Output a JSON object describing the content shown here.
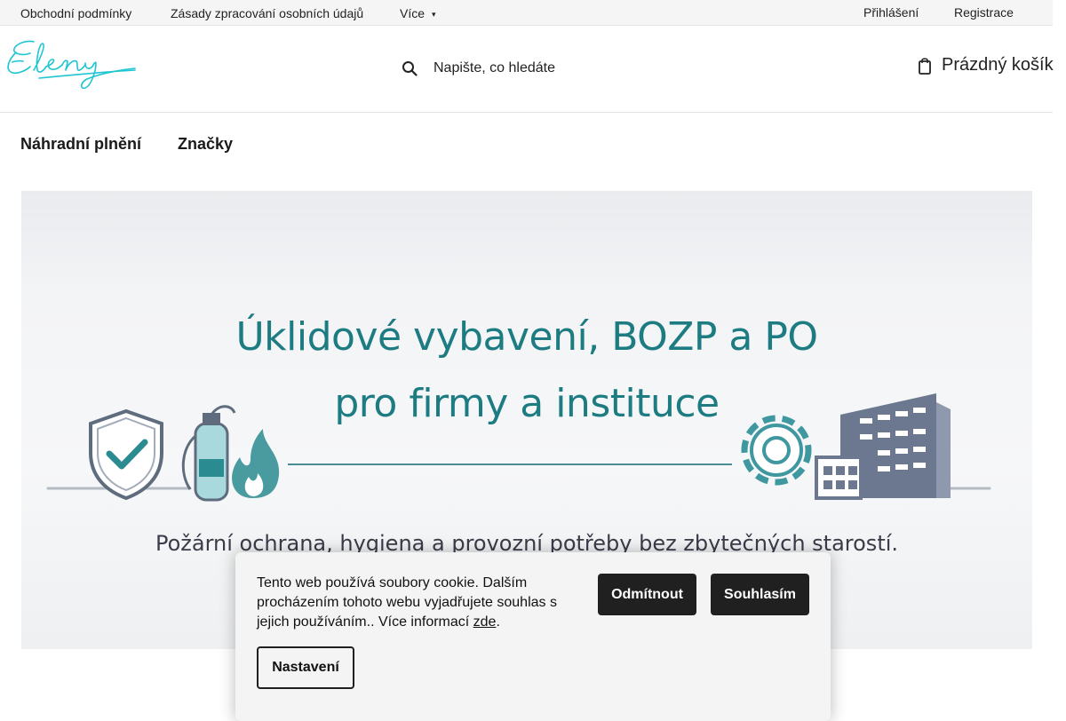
{
  "topbar": {
    "links": [
      "Obchodní podmínky",
      "Zásady zpracování osobních údajů",
      "Více"
    ],
    "login": "Přihlášení",
    "register": "Registrace"
  },
  "header": {
    "logo_text": "Eleny",
    "search_placeholder": "Napište, co hledáte",
    "cart_label": "Prázdný košík"
  },
  "nav": {
    "items": [
      "Náhradní plnění",
      "Značky"
    ]
  },
  "banner": {
    "title_line1": "Úklidové vybavení, BOZP a PO",
    "title_line2": "pro firmy a instituce",
    "subtitle": "Požární ochrana, hygiena a provozní potřeby bez zbytečných starostí."
  },
  "cookie": {
    "text": "Tento web používá soubory cookie. Dalším procházením tohoto webu vyjadřujete souhlas s jejich používáním.. Více informací ",
    "link_text": "zde",
    "text_end": ".",
    "reject_label": "Odmítnout",
    "accept_label": "Souhlasím",
    "settings_label": "Nastavení"
  },
  "colors": {
    "accent_teal": "#1d7b82",
    "logo_cyan": "#1fc6d2",
    "button_dark": "#202020"
  }
}
